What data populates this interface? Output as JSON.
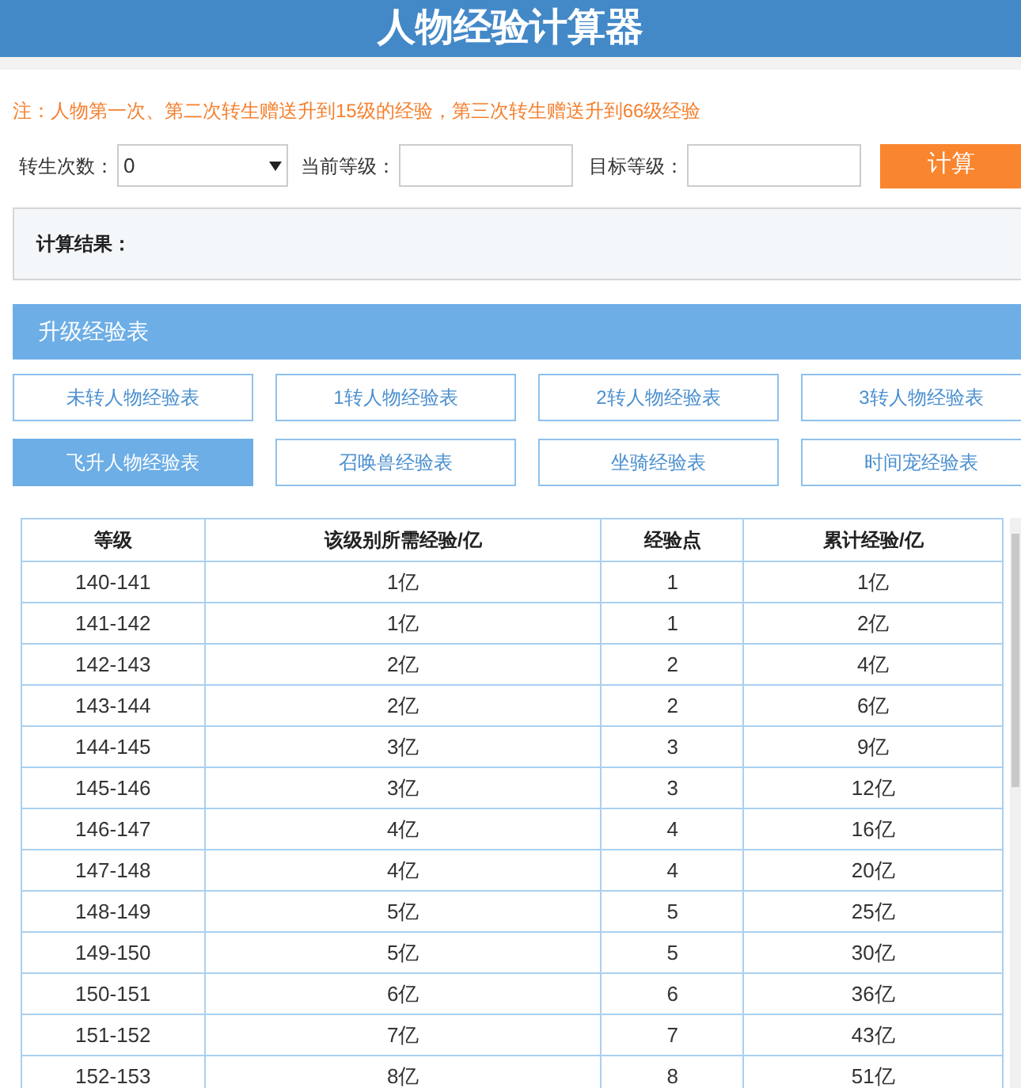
{
  "title": "人物经验计算器",
  "note": "注：人物第一次、第二次转生赠送升到15级的经验，第三次转生赠送升到66级经验",
  "form": {
    "rebirth_label": "转生次数：",
    "rebirth_value": "0",
    "current_label": "当前等级：",
    "target_label": "目标等级：",
    "button": "计算"
  },
  "result": {
    "label": "计算结果："
  },
  "section": {
    "title": "升级经验表"
  },
  "tabs": [
    {
      "label": "未转人物经验表",
      "selected": false
    },
    {
      "label": "1转人物经验表",
      "selected": false
    },
    {
      "label": "2转人物经验表",
      "selected": false
    },
    {
      "label": "3转人物经验表",
      "selected": false
    },
    {
      "label": "飞升人物经验表",
      "selected": true
    },
    {
      "label": "召唤兽经验表",
      "selected": false
    },
    {
      "label": "坐骑经验表",
      "selected": false
    },
    {
      "label": "时间宠经验表",
      "selected": false
    }
  ],
  "table": {
    "columns": [
      "等级",
      "该级别所需经验/亿",
      "经验点",
      "累计经验/亿"
    ],
    "rows": [
      [
        "140-141",
        "1亿",
        "1",
        "1亿"
      ],
      [
        "141-142",
        "1亿",
        "1",
        "2亿"
      ],
      [
        "142-143",
        "2亿",
        "2",
        "4亿"
      ],
      [
        "143-144",
        "2亿",
        "2",
        "6亿"
      ],
      [
        "144-145",
        "3亿",
        "3",
        "9亿"
      ],
      [
        "145-146",
        "3亿",
        "3",
        "12亿"
      ],
      [
        "146-147",
        "4亿",
        "4",
        "16亿"
      ],
      [
        "147-148",
        "4亿",
        "4",
        "20亿"
      ],
      [
        "148-149",
        "5亿",
        "5",
        "25亿"
      ],
      [
        "149-150",
        "5亿",
        "5",
        "30亿"
      ],
      [
        "150-151",
        "6亿",
        "6",
        "36亿"
      ],
      [
        "151-152",
        "7亿",
        "7",
        "43亿"
      ],
      [
        "152-153",
        "8亿",
        "8",
        "51亿"
      ]
    ]
  }
}
